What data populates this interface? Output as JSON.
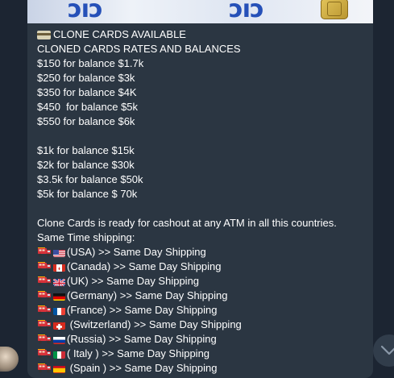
{
  "message": {
    "header": "CLONE CARDS AVAILABLE",
    "lines": [
      "CLONED CARDS RATES AND BALANCES",
      "$150 for balance $1.7k",
      "$250 for balance $3k",
      "$350 for balance $4K",
      "$450  for balance $5k",
      "$550 for balance $6k",
      "$1k for balance $15k",
      "$2k for balance $30k",
      "$3.5k for balance $50k",
      "$5k for balance $ 70k",
      "Clone Cards is ready for cashout at any ATM in all this countries.",
      "Same Time shipping:"
    ],
    "shipping": [
      {
        "text": "(USA) >> Same Day Shipping",
        "flag": "usa"
      },
      {
        "text": "(Canada) >> Same Day Shipping",
        "flag": "canada"
      },
      {
        "text": "(UK) >> Same Day Shipping",
        "flag": "uk"
      },
      {
        "text": "(Germany) >> Same Day Shipping",
        "flag": "germany"
      },
      {
        "text": "(France) >> Same Day Shipping",
        "flag": "france"
      },
      {
        "text": " (Switzerland) >> Same Day Shipping",
        "flag": "switzerland"
      },
      {
        "text": "(Russia) >> Same Day Shipping",
        "flag": "russia"
      },
      {
        "text": "( Italy ) >> Same Day Shipping",
        "flag": "italy"
      },
      {
        "text": " (Spain ) >> Same Day Shipping",
        "flag": "spain"
      }
    ]
  },
  "icons": {
    "card": "credit-card-icon",
    "truck": "fire-engine-icon",
    "scroll": "chevron-down-icon"
  },
  "colors": {
    "background": "#1c2532",
    "bubble": "#2b3642",
    "text": "#ffffff"
  }
}
